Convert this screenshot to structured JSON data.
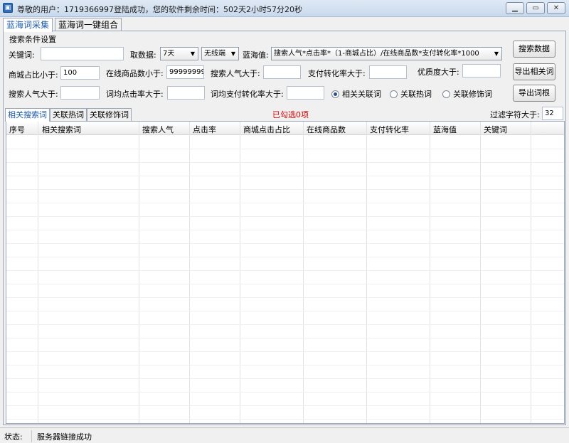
{
  "window": {
    "app_icon": "app-icon",
    "title": "尊敬的用户：1719366997登陆成功，您的软件剩余时间：502天2小时57分20秒",
    "controls": [
      "minimize-icon",
      "restore-icon",
      "close-icon"
    ]
  },
  "top_tabs": [
    {
      "label": "蓝海词采集",
      "active": true
    },
    {
      "label": "蓝海词一键组合",
      "active": false
    }
  ],
  "search_settings": {
    "group_label": "搜索条件设置",
    "keyword_label": "关键词:",
    "keyword_value": "",
    "fetch_label": "取数据:",
    "fetch_period": "7天",
    "device": "无线端",
    "blue_sea_label": "蓝海值:",
    "blue_sea_formula": "搜索人气*点击率*（1-商城占比）/在线商品数*支付转化率*1000",
    "mall_ratio_label": "商城占比小于:",
    "mall_ratio_value": "100",
    "online_goods_label": "在线商品数小于:",
    "online_goods_value": "99999999",
    "search_pop_gt_label": "搜索人气大于:",
    "search_pop_gt_value": "",
    "pay_conv_label": "支付转化率大于:",
    "pay_conv_value": "",
    "quality_label": "优质度大于:",
    "quality_value": "",
    "search_pop_gt2_label": "搜索人气大于:",
    "search_pop_gt2_value": "",
    "word_click_label": "词均点击率大于:",
    "word_click_value": "",
    "word_pay_label": "词均支付转化率大于:",
    "word_pay_value": "",
    "radio_options": [
      {
        "label": "相关关联词",
        "checked": true
      },
      {
        "label": "关联热词",
        "checked": false
      },
      {
        "label": "关联修饰词",
        "checked": false
      }
    ]
  },
  "buttons": {
    "search": "搜索数据",
    "export_related": "导出相关词",
    "export_roots": "导出词根"
  },
  "sub_tabs": [
    {
      "label": "相关搜索词",
      "active": true
    },
    {
      "label": "关联热词",
      "active": false
    },
    {
      "label": "关联修饰词",
      "active": false
    }
  ],
  "selection_status": "已勾选0项",
  "filter": {
    "label": "过滤字符大于:",
    "value": "32"
  },
  "table": {
    "columns": [
      "序号",
      "相关搜索词",
      "搜索人气",
      "点击率",
      "商城点击占比",
      "在线商品数",
      "支付转化率",
      "蓝海值",
      "关键词"
    ],
    "rows": []
  },
  "status_bar": {
    "label": "状态:",
    "message": "服务器链接成功"
  },
  "colors": {
    "accent_tab_text": "#1d5aa8",
    "selected_count": "#d40000"
  }
}
